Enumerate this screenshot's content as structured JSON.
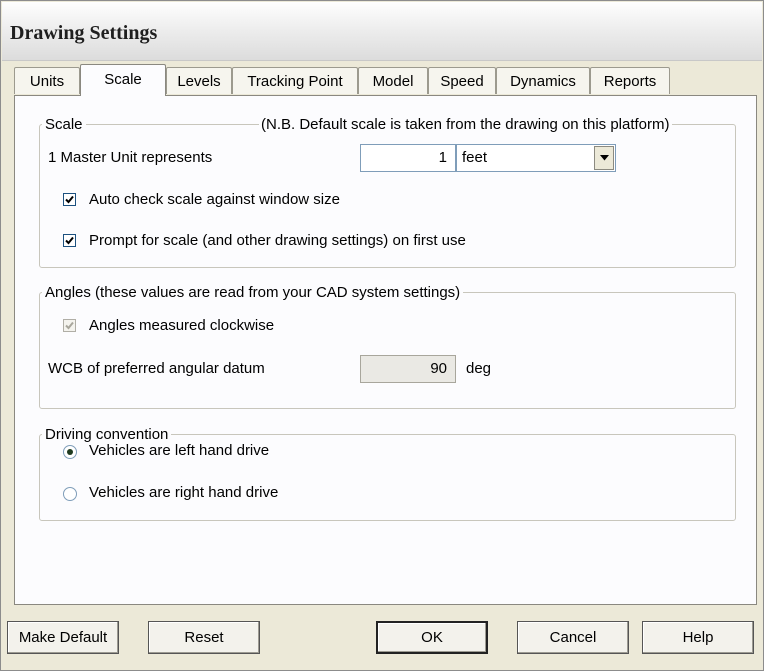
{
  "window": {
    "title": "Drawing Settings"
  },
  "tabs": [
    {
      "label": "Units"
    },
    {
      "label": "Scale"
    },
    {
      "label": "Levels"
    },
    {
      "label": "Tracking Point"
    },
    {
      "label": "Model"
    },
    {
      "label": "Speed"
    },
    {
      "label": "Dynamics"
    },
    {
      "label": "Reports"
    }
  ],
  "active_tab": "Scale",
  "scale_group": {
    "legend": "Scale",
    "note": "(N.B.  Default scale is taken from the drawing on this platform)",
    "master_unit_label": "1 Master Unit represents",
    "master_unit_value": "1",
    "unit_select_value": "feet",
    "auto_check_label": "Auto check scale against window size",
    "auto_check_checked": true,
    "prompt_label": "Prompt for scale (and other drawing settings) on first use",
    "prompt_checked": true
  },
  "angles_group": {
    "legend": "Angles  (these values are read from your CAD system settings)",
    "clockwise_label": "Angles measured clockwise",
    "clockwise_checked": true,
    "wcb_label": "WCB of preferred angular datum",
    "wcb_value": "90",
    "wcb_unit": "deg"
  },
  "driving_group": {
    "legend": "Driving convention",
    "left_label": "Vehicles are left hand drive",
    "right_label": "Vehicles are right hand drive",
    "selected": "left"
  },
  "buttons": {
    "make_default": "Make Default",
    "reset": "Reset",
    "ok": "OK",
    "cancel": "Cancel",
    "help": "Help"
  }
}
